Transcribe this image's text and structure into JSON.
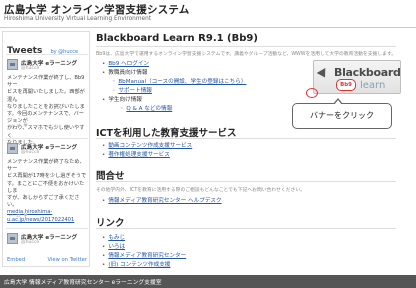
{
  "header": {
    "title_ja": "広島大学 オンライン学習支援システム",
    "title_en": "Hiroshima University Virtual Learning Environment"
  },
  "sidebar": {
    "title": "Tweets",
    "by": "by @hucce",
    "tweets": [
      {
        "name": "広島大学 eラーニング",
        "handle": "@hucce",
        "body": [
          "メンテナンス作業が終了し、Bb9サー",
          "ビスを再開いたしました。西部が混ん",
          "なりましたことをお詫びいたしま",
          "す。今回のメンテナンスで、バージョンが",
          "かわり、スマホでも少し使いやすく",
          "なりました。"
        ]
      },
      {
        "name": "広島大学 eラーニング",
        "handle": "@hucce",
        "body": [
          "メンテナンス作業が終了なため、サー",
          "ビス再開が17時を少し過ぎそうで",
          "す。まことにご不便をおかけいたしま",
          "すが、あしからずご了承ください。",
          "media.hiroshima-",
          "u.ac.jp/news/2017022401"
        ]
      },
      {
        "name": "広島大学 eラーニング",
        "handle": "@hucce",
        "body": []
      }
    ],
    "footer": {
      "embed": "Embed",
      "view": "View on Twitter"
    }
  },
  "main": {
    "title": "Blackboard Learn R9.1 (Bb9)",
    "intro": "Bb9は、広島大学で運用するオンライン学習支援システムです。講義やグループ活動など、WWWを活用して大学の教育活動を支援します。",
    "bullets": [
      {
        "text": "Bb9 ヘログイン",
        "level": 0,
        "link": true
      },
      {
        "text": "教職員向け情報",
        "level": 0,
        "link": false
      },
      {
        "text": "BbManual（コースの開設、学生の登録はこちら）",
        "level": 1,
        "link": true
      },
      {
        "text": "サポート情報",
        "level": 1,
        "link": true
      },
      {
        "text": "学生向け情報",
        "level": 0,
        "link": false
      },
      {
        "text": "Q & A などの情報",
        "level": 2,
        "link": true
      }
    ],
    "banner": {
      "logo": "Blackboard",
      "learn": "learn",
      "version": "Bb9"
    },
    "callout": "バナーをクリック",
    "ict": {
      "title": "ICTを利用した教育支援サービス",
      "links": [
        "動画コンテンツ作成支援サービス",
        "著作権処理支援サービス"
      ]
    },
    "contact": {
      "title": "問合せ",
      "text": "その他学内外、ICTを教育に活用する際のご相談もどんなことでも下記へお問い合わせください。",
      "link": "情報メディア教育研究センター ヘルプデスク"
    },
    "links": {
      "title": "リンク",
      "items": [
        "もみじ",
        "いろは",
        "情報メディア教育研究センター",
        "(旧) コンテンツ作成支援"
      ]
    }
  },
  "footer": {
    "text": "広島大学 情報メディア教育研究センター eラーニング支援室"
  }
}
